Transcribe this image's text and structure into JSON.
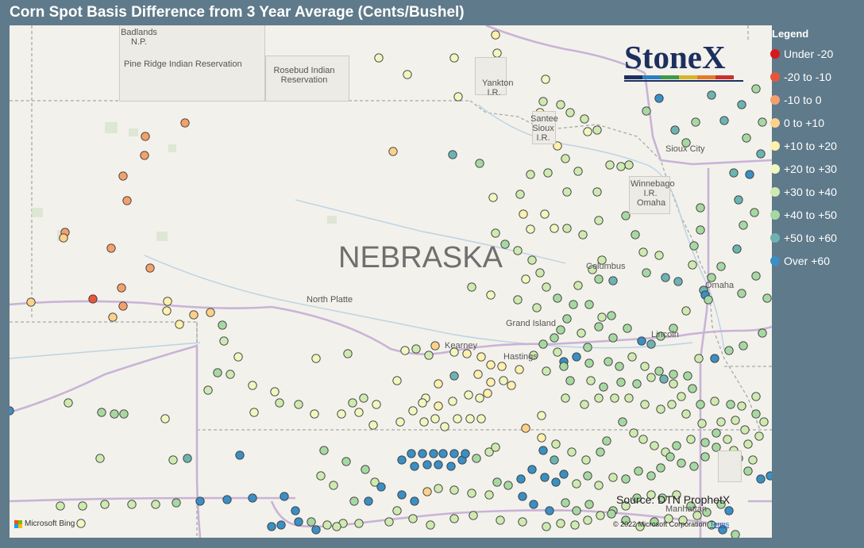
{
  "title": "Corn Spot Basis Difference from 3 Year Average (Cents/Bushel)",
  "map": {
    "state_label": "NEBRASKA",
    "places": [
      "Badlands N.P.",
      "Pine Ridge Indian Reservation",
      "Rosebud Indian Reservation",
      "Yankton I.R.",
      "Santee Sioux I.R.",
      "Sioux City",
      "Winnebago I.R.",
      "Omaha",
      "Columbus",
      "Omaha",
      "North Platte",
      "Grand Island",
      "Kearney",
      "Hastings",
      "Lincoln",
      "Manhattan"
    ],
    "source": "Source: DTN ProphetX",
    "copyright": "© 2022 Microsoft Corporation",
    "terms": "Terms",
    "bing": "Microsoft Bing",
    "brand": "StoneX"
  },
  "legend": {
    "title": "Legend",
    "items": [
      {
        "label": "Under -20",
        "color": "#d7191c"
      },
      {
        "label": "-20 to -10",
        "color": "#e8563a"
      },
      {
        "label": "-10 to 0",
        "color": "#f4a06a"
      },
      {
        "label": "0 to +10",
        "color": "#fdd18a"
      },
      {
        "label": "+10 to +20",
        "color": "#fef0ad"
      },
      {
        "label": "+20 to +30",
        "color": "#f0f8c0"
      },
      {
        "label": "+30 to +40",
        "color": "#cfeab0"
      },
      {
        "label": "+40 to +50",
        "color": "#a8d8a2"
      },
      {
        "label": "+50 to +60",
        "color": "#6cb3b1"
      },
      {
        "label": "Over +60",
        "color": "#3a8fc4"
      }
    ]
  },
  "brand_colors": [
    "#1d2f5e",
    "#2e7fbf",
    "#3d9a4a",
    "#d6b52a",
    "#e07b2a",
    "#c8302f"
  ]
}
